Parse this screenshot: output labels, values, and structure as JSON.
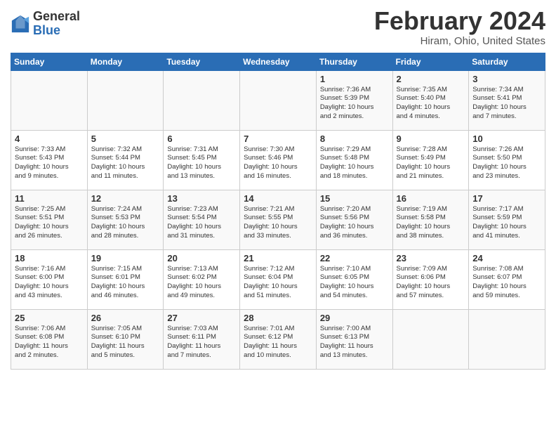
{
  "header": {
    "logo_general": "General",
    "logo_blue": "Blue",
    "month_title": "February 2024",
    "location": "Hiram, Ohio, United States"
  },
  "weekdays": [
    "Sunday",
    "Monday",
    "Tuesday",
    "Wednesday",
    "Thursday",
    "Friday",
    "Saturday"
  ],
  "weeks": [
    [
      {
        "day": "",
        "info": ""
      },
      {
        "day": "",
        "info": ""
      },
      {
        "day": "",
        "info": ""
      },
      {
        "day": "",
        "info": ""
      },
      {
        "day": "1",
        "info": "Sunrise: 7:36 AM\nSunset: 5:39 PM\nDaylight: 10 hours\nand 2 minutes."
      },
      {
        "day": "2",
        "info": "Sunrise: 7:35 AM\nSunset: 5:40 PM\nDaylight: 10 hours\nand 4 minutes."
      },
      {
        "day": "3",
        "info": "Sunrise: 7:34 AM\nSunset: 5:41 PM\nDaylight: 10 hours\nand 7 minutes."
      }
    ],
    [
      {
        "day": "4",
        "info": "Sunrise: 7:33 AM\nSunset: 5:43 PM\nDaylight: 10 hours\nand 9 minutes."
      },
      {
        "day": "5",
        "info": "Sunrise: 7:32 AM\nSunset: 5:44 PM\nDaylight: 10 hours\nand 11 minutes."
      },
      {
        "day": "6",
        "info": "Sunrise: 7:31 AM\nSunset: 5:45 PM\nDaylight: 10 hours\nand 13 minutes."
      },
      {
        "day": "7",
        "info": "Sunrise: 7:30 AM\nSunset: 5:46 PM\nDaylight: 10 hours\nand 16 minutes."
      },
      {
        "day": "8",
        "info": "Sunrise: 7:29 AM\nSunset: 5:48 PM\nDaylight: 10 hours\nand 18 minutes."
      },
      {
        "day": "9",
        "info": "Sunrise: 7:28 AM\nSunset: 5:49 PM\nDaylight: 10 hours\nand 21 minutes."
      },
      {
        "day": "10",
        "info": "Sunrise: 7:26 AM\nSunset: 5:50 PM\nDaylight: 10 hours\nand 23 minutes."
      }
    ],
    [
      {
        "day": "11",
        "info": "Sunrise: 7:25 AM\nSunset: 5:51 PM\nDaylight: 10 hours\nand 26 minutes."
      },
      {
        "day": "12",
        "info": "Sunrise: 7:24 AM\nSunset: 5:53 PM\nDaylight: 10 hours\nand 28 minutes."
      },
      {
        "day": "13",
        "info": "Sunrise: 7:23 AM\nSunset: 5:54 PM\nDaylight: 10 hours\nand 31 minutes."
      },
      {
        "day": "14",
        "info": "Sunrise: 7:21 AM\nSunset: 5:55 PM\nDaylight: 10 hours\nand 33 minutes."
      },
      {
        "day": "15",
        "info": "Sunrise: 7:20 AM\nSunset: 5:56 PM\nDaylight: 10 hours\nand 36 minutes."
      },
      {
        "day": "16",
        "info": "Sunrise: 7:19 AM\nSunset: 5:58 PM\nDaylight: 10 hours\nand 38 minutes."
      },
      {
        "day": "17",
        "info": "Sunrise: 7:17 AM\nSunset: 5:59 PM\nDaylight: 10 hours\nand 41 minutes."
      }
    ],
    [
      {
        "day": "18",
        "info": "Sunrise: 7:16 AM\nSunset: 6:00 PM\nDaylight: 10 hours\nand 43 minutes."
      },
      {
        "day": "19",
        "info": "Sunrise: 7:15 AM\nSunset: 6:01 PM\nDaylight: 10 hours\nand 46 minutes."
      },
      {
        "day": "20",
        "info": "Sunrise: 7:13 AM\nSunset: 6:02 PM\nDaylight: 10 hours\nand 49 minutes."
      },
      {
        "day": "21",
        "info": "Sunrise: 7:12 AM\nSunset: 6:04 PM\nDaylight: 10 hours\nand 51 minutes."
      },
      {
        "day": "22",
        "info": "Sunrise: 7:10 AM\nSunset: 6:05 PM\nDaylight: 10 hours\nand 54 minutes."
      },
      {
        "day": "23",
        "info": "Sunrise: 7:09 AM\nSunset: 6:06 PM\nDaylight: 10 hours\nand 57 minutes."
      },
      {
        "day": "24",
        "info": "Sunrise: 7:08 AM\nSunset: 6:07 PM\nDaylight: 10 hours\nand 59 minutes."
      }
    ],
    [
      {
        "day": "25",
        "info": "Sunrise: 7:06 AM\nSunset: 6:08 PM\nDaylight: 11 hours\nand 2 minutes."
      },
      {
        "day": "26",
        "info": "Sunrise: 7:05 AM\nSunset: 6:10 PM\nDaylight: 11 hours\nand 5 minutes."
      },
      {
        "day": "27",
        "info": "Sunrise: 7:03 AM\nSunset: 6:11 PM\nDaylight: 11 hours\nand 7 minutes."
      },
      {
        "day": "28",
        "info": "Sunrise: 7:01 AM\nSunset: 6:12 PM\nDaylight: 11 hours\nand 10 minutes."
      },
      {
        "day": "29",
        "info": "Sunrise: 7:00 AM\nSunset: 6:13 PM\nDaylight: 11 hours\nand 13 minutes."
      },
      {
        "day": "",
        "info": ""
      },
      {
        "day": "",
        "info": ""
      }
    ]
  ]
}
